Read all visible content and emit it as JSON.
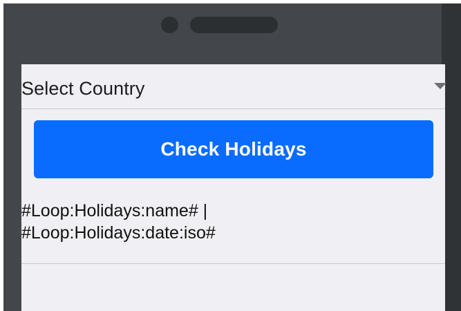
{
  "select": {
    "label": "Select Country"
  },
  "button": {
    "label": "Check Holidays"
  },
  "list_item": {
    "line1": "#Loop:Holidays:name# |",
    "line2": "#Loop:Holidays:date:iso#"
  },
  "colors": {
    "accent": "#0a6cff",
    "device_frame": "#43474b",
    "screen_bg": "#efeff4"
  }
}
